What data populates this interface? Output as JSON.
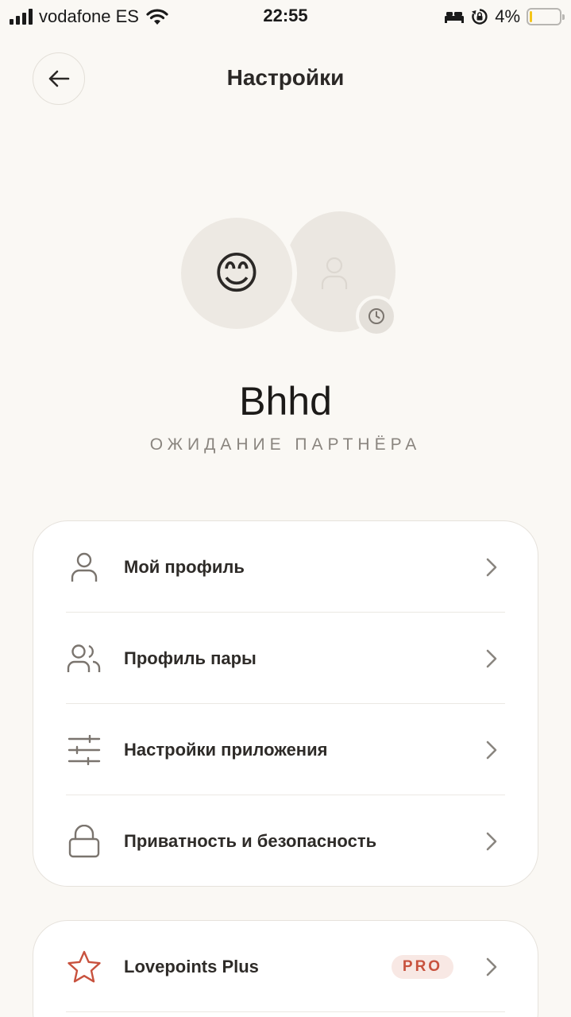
{
  "status_bar": {
    "carrier": "vodafone ES",
    "time": "22:55",
    "battery_percent": "4%",
    "battery_level": 0.04,
    "icons": [
      "signal-icon",
      "wifi-icon",
      "bed-icon",
      "rotation-lock-icon",
      "battery-icon"
    ]
  },
  "header": {
    "title": "Настройки",
    "back_icon": "arrow-left-icon"
  },
  "profile": {
    "user_avatar_emoji": "😊",
    "partner_avatar_icon": "person-placeholder-icon",
    "partner_badge_icon": "clock-icon",
    "name": "Bhhd",
    "status": "ОЖИДАНИЕ ПАРТНЁРА"
  },
  "menu": {
    "items": [
      {
        "label": "Мой профиль",
        "icon": "user-icon"
      },
      {
        "label": "Профиль пары",
        "icon": "users-icon"
      },
      {
        "label": "Настройки приложения",
        "icon": "sliders-icon"
      },
      {
        "label": "Приватность и безопасность",
        "icon": "lock-icon"
      }
    ]
  },
  "pro_menu": {
    "items": [
      {
        "label": "Lovepoints Plus",
        "icon": "star-icon",
        "badge": "PRO"
      }
    ]
  },
  "colors": {
    "background": "#faf8f4",
    "card": "#ffffff",
    "text": "#2b2826",
    "muted": "#8a857f",
    "accent": "#c8523e",
    "badge_bg": "#f8e8e4"
  }
}
